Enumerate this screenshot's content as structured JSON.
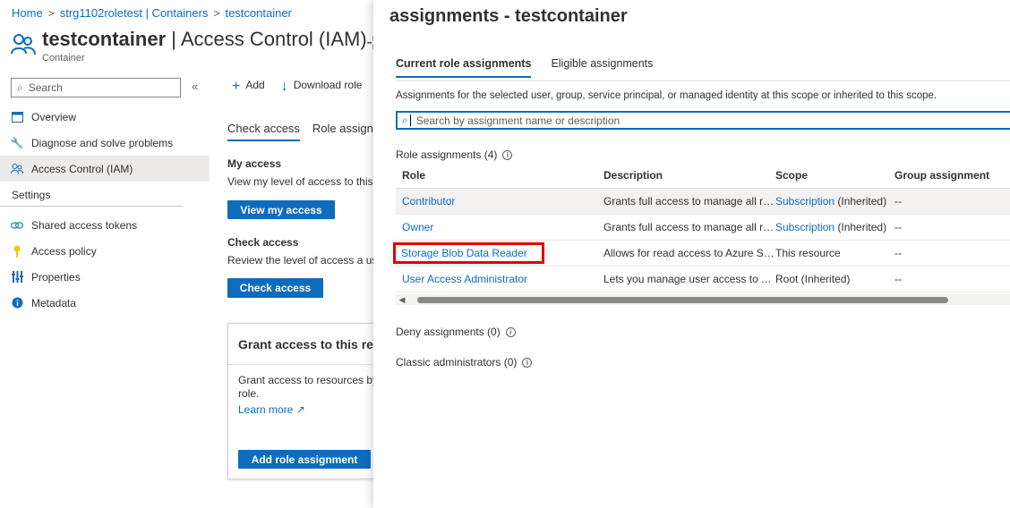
{
  "breadcrumb": [
    "Home",
    "strg1102roletest | Containers",
    "testcontainer"
  ],
  "header": {
    "title_bold": "testcontainer",
    "title_rest": " | Access Control (IAM)",
    "subtitle": "Container"
  },
  "sidebar": {
    "search_placeholder": "Search",
    "items": [
      {
        "label": "Overview",
        "icon": "overview-icon"
      },
      {
        "label": "Diagnose and solve problems",
        "icon": "wrench-icon"
      },
      {
        "label": "Access Control (IAM)",
        "icon": "people-icon"
      }
    ],
    "section": "Settings",
    "settings_items": [
      {
        "label": "Shared access tokens",
        "icon": "link-icon"
      },
      {
        "label": "Access policy",
        "icon": "key-icon"
      },
      {
        "label": "Properties",
        "icon": "properties-icon"
      },
      {
        "label": "Metadata",
        "icon": "info-icon"
      }
    ]
  },
  "toolbar": {
    "add": "Add",
    "download": "Download role"
  },
  "bg_tabs": {
    "check_access": "Check access",
    "role_assign": "Role assignm"
  },
  "my_access": {
    "title": "My access",
    "text": "View my level of access to this r",
    "button": "View my access"
  },
  "check_access": {
    "title": "Check access",
    "text": "Review the level of access a use",
    "button": "Check access"
  },
  "grant_card": {
    "title": "Grant access to this reso",
    "text": "Grant access to resources by a role.",
    "learn_more": "Learn more",
    "button": "Add role assignment"
  },
  "panel": {
    "title": "assignments - testcontainer",
    "tabs": [
      "Current role assignments",
      "Eligible assignments"
    ],
    "description": "Assignments for the selected user, group, service principal, or managed identity at this scope or inherited to this scope.",
    "search_placeholder": "Search by assignment name or description",
    "role_count": "Role assignments (4)",
    "columns": [
      "Role",
      "Description",
      "Scope",
      "Group assignment"
    ],
    "rows": [
      {
        "role": "Contributor",
        "description": "Grants full access to manage all re...",
        "scope_link": "Subscription",
        "scope_suffix": " (Inherited)",
        "group": "--"
      },
      {
        "role": "Owner",
        "description": "Grants full access to manage all re...",
        "scope_link": "Subscription",
        "scope_suffix": " (Inherited)",
        "group": "--"
      },
      {
        "role": "Storage Blob Data Reader",
        "description": "Allows for read access to Azure St...",
        "scope_link": "",
        "scope_suffix": "This resource",
        "group": "--"
      },
      {
        "role": "User Access Administrator",
        "description": "Lets you manage user access to A...",
        "scope_link": "",
        "scope_suffix": "Root (Inherited)",
        "group": "--"
      }
    ],
    "deny": "Deny assignments (0)",
    "classic": "Classic administrators (0)"
  },
  "colors": {
    "accent": "#0f6cbd",
    "highlight": "#e00000"
  }
}
